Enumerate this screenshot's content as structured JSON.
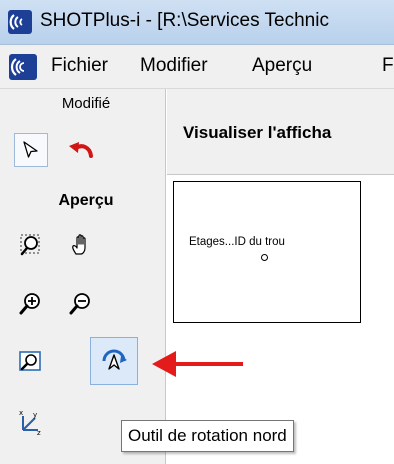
{
  "window": {
    "title": "SHOTPlus-i - [R:\\Services Technic"
  },
  "menubar": {
    "items": [
      "Fichier",
      "Modifier",
      "Aperçu",
      "F"
    ]
  },
  "toolbar": {
    "section_modifie": "Modifié",
    "section_apercu": "Aperçu",
    "icons": {
      "select": "arrow-pointer-icon",
      "undo": "undo-arrow-icon",
      "zoom_window": "zoom-window-icon",
      "pan": "hand-icon",
      "zoom_in": "zoom-in-icon",
      "zoom_out": "zoom-out-icon",
      "zoom_extents": "zoom-extents-icon",
      "north_rotation": "north-rotation-icon",
      "axis_rotation": "axis-rotation-icon"
    }
  },
  "main": {
    "header_title": "Visualiser l'afficha",
    "preview_label": "Etages...ID du trou"
  },
  "tooltip": {
    "text": "Outil de rotation nord"
  },
  "colors": {
    "annotation_arrow": "#e31b1b",
    "active_tool_bg": "#dce9f8",
    "toolbar_bg": "#f0f0f0"
  }
}
